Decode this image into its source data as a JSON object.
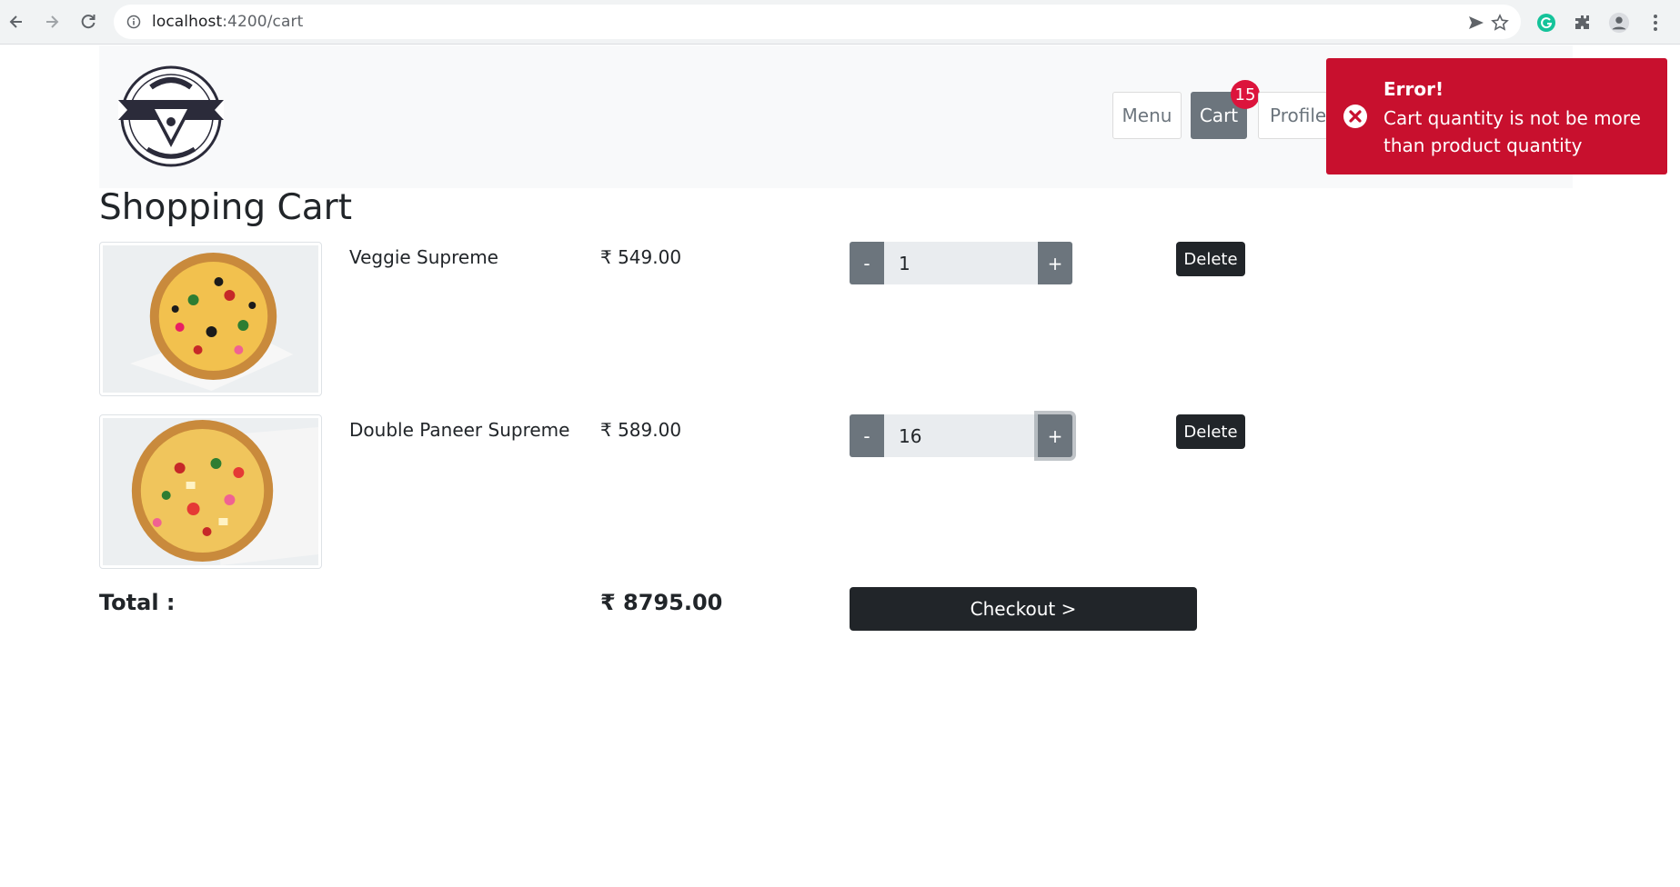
{
  "browser": {
    "url_host": "localhost",
    "url_path": ":4200/cart"
  },
  "nav": {
    "menu": "Menu",
    "cart": "Cart",
    "cart_count": "15",
    "profile": "Profile"
  },
  "page": {
    "title": "Shopping Cart"
  },
  "cart": {
    "items": [
      {
        "name": "Veggie Supreme",
        "price": "₹ 549.00",
        "qty": "1",
        "minus": "-",
        "plus": "+",
        "delete": "Delete"
      },
      {
        "name": "Double Paneer Supreme",
        "price": "₹ 589.00",
        "qty": "16",
        "minus": "-",
        "plus": "+",
        "delete": "Delete"
      }
    ],
    "total_label": "Total :",
    "total_value": "₹ 8795.00",
    "checkout": "Checkout >"
  },
  "toast": {
    "title": "Error!",
    "message": "Cart quantity is not be more than product quantity",
    "color": "#c8102e"
  },
  "colors": {
    "badge": "#dc143c",
    "dark_button": "#212529",
    "secondary": "#6c757d"
  }
}
